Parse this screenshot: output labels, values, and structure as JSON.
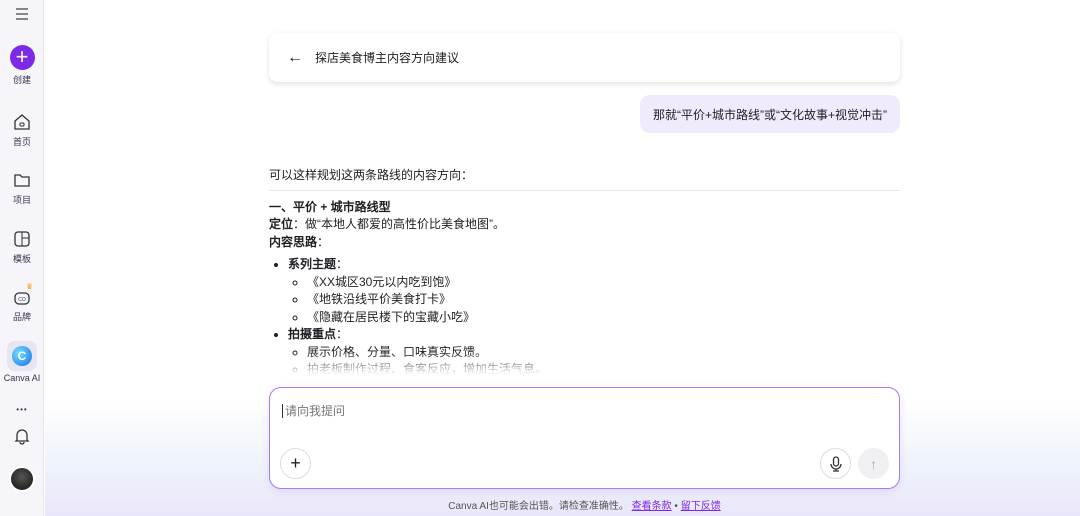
{
  "sidebar": {
    "create": "创建",
    "home": "首页",
    "projects": "项目",
    "templates": "模板",
    "brand": "品牌",
    "canva_ai": "Canva AI",
    "more": "•••"
  },
  "header": {
    "title": "探店美食博主内容方向建议"
  },
  "user_message": "那就“平价+城市路线”或“文化故事+视觉冲击”",
  "answer": {
    "intro": "可以这样规划这两条路线的内容方向：",
    "section1_title": "一、平价 + 城市路线型",
    "positioning_label": "定位",
    "positioning_text": "：做“本地人都爱的高性价比美食地图”。",
    "ideas_label": "内容思路",
    "ideas_colon": "：",
    "bullets": [
      {
        "label": "系列主题",
        "colon": "：",
        "items": [
          "《XX城区30元以内吃到饱》",
          "《地铁沿线平价美食打卡》",
          "《隐藏在居民楼下的宝藏小吃》"
        ]
      },
      {
        "label": "拍摄重点",
        "colon": "：",
        "items": [
          "展示价格、分量、口味真实反馈。",
          "拍老板制作过程、食客反应，增加生活气息。"
        ]
      }
    ]
  },
  "input": {
    "placeholder": "请向我提问"
  },
  "footer": {
    "disclaimer": "Canva AI也可能会出错。请检查准确性。",
    "terms": "查看条款",
    "sep": "•",
    "feedback": "留下反馈"
  },
  "colors": {
    "accent": "#7d2ae8",
    "bubble": "#efeafc"
  }
}
